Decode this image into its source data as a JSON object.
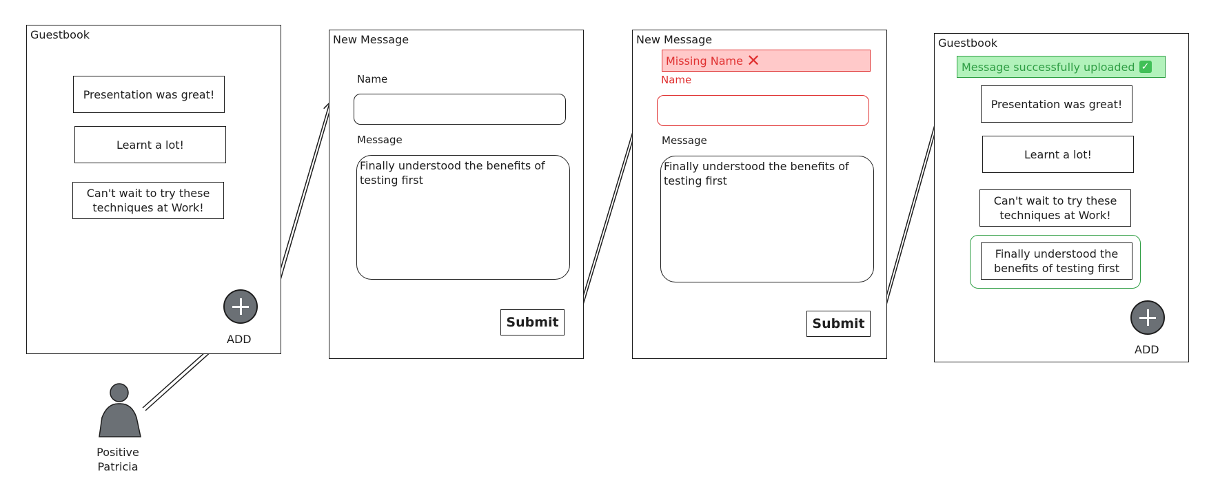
{
  "screen1": {
    "title": "Guestbook",
    "messages": [
      "Presentation was great!",
      "Learnt a lot!",
      "Can't wait to try these techniques at Work!"
    ],
    "add_label": "ADD"
  },
  "screen2": {
    "title": "New Message",
    "name_label": "Name",
    "name_value": "",
    "message_label": "Message",
    "message_value": "Finally understood the benefits of testing first",
    "submit_label": "Submit"
  },
  "screen3": {
    "title": "New Message",
    "error_text": "Missing Name",
    "error_icon": "✕",
    "name_label": "Name",
    "name_value": "",
    "message_label": "Message",
    "message_value": "Finally understood the benefits of testing first",
    "submit_label": "Submit"
  },
  "screen4": {
    "title": "Guestbook",
    "success_text": "Message successfully uploaded",
    "success_icon": "✓",
    "messages": [
      "Presentation was great!",
      "Learnt a lot!",
      "Can't wait to try these techniques at Work!"
    ],
    "new_message": "Finally understood the benefits of testing first",
    "add_label": "ADD"
  },
  "persona": {
    "name_line1": "Positive",
    "name_line2": "Patricia"
  },
  "colors": {
    "stroke": "#1e1e1e",
    "error_fill": "#ffc9c9",
    "error_stroke": "#e03131",
    "success_fill": "#b2f2bb",
    "success_stroke": "#2f9e44",
    "button_fill": "#6b7075"
  }
}
